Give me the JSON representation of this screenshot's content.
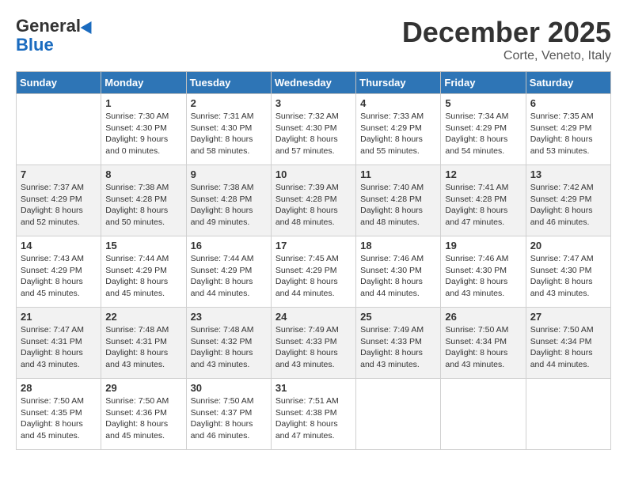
{
  "header": {
    "logo_general": "General",
    "logo_blue": "Blue",
    "month_title": "December 2025",
    "location": "Corte, Veneto, Italy"
  },
  "days_of_week": [
    "Sunday",
    "Monday",
    "Tuesday",
    "Wednesday",
    "Thursday",
    "Friday",
    "Saturday"
  ],
  "weeks": [
    [
      {
        "day": "",
        "sunrise": "",
        "sunset": "",
        "daylight": ""
      },
      {
        "day": "1",
        "sunrise": "Sunrise: 7:30 AM",
        "sunset": "Sunset: 4:30 PM",
        "daylight": "Daylight: 9 hours and 0 minutes."
      },
      {
        "day": "2",
        "sunrise": "Sunrise: 7:31 AM",
        "sunset": "Sunset: 4:30 PM",
        "daylight": "Daylight: 8 hours and 58 minutes."
      },
      {
        "day": "3",
        "sunrise": "Sunrise: 7:32 AM",
        "sunset": "Sunset: 4:30 PM",
        "daylight": "Daylight: 8 hours and 57 minutes."
      },
      {
        "day": "4",
        "sunrise": "Sunrise: 7:33 AM",
        "sunset": "Sunset: 4:29 PM",
        "daylight": "Daylight: 8 hours and 55 minutes."
      },
      {
        "day": "5",
        "sunrise": "Sunrise: 7:34 AM",
        "sunset": "Sunset: 4:29 PM",
        "daylight": "Daylight: 8 hours and 54 minutes."
      },
      {
        "day": "6",
        "sunrise": "Sunrise: 7:35 AM",
        "sunset": "Sunset: 4:29 PM",
        "daylight": "Daylight: 8 hours and 53 minutes."
      }
    ],
    [
      {
        "day": "7",
        "sunrise": "Sunrise: 7:37 AM",
        "sunset": "Sunset: 4:29 PM",
        "daylight": "Daylight: 8 hours and 52 minutes."
      },
      {
        "day": "8",
        "sunrise": "Sunrise: 7:38 AM",
        "sunset": "Sunset: 4:28 PM",
        "daylight": "Daylight: 8 hours and 50 minutes."
      },
      {
        "day": "9",
        "sunrise": "Sunrise: 7:38 AM",
        "sunset": "Sunset: 4:28 PM",
        "daylight": "Daylight: 8 hours and 49 minutes."
      },
      {
        "day": "10",
        "sunrise": "Sunrise: 7:39 AM",
        "sunset": "Sunset: 4:28 PM",
        "daylight": "Daylight: 8 hours and 48 minutes."
      },
      {
        "day": "11",
        "sunrise": "Sunrise: 7:40 AM",
        "sunset": "Sunset: 4:28 PM",
        "daylight": "Daylight: 8 hours and 48 minutes."
      },
      {
        "day": "12",
        "sunrise": "Sunrise: 7:41 AM",
        "sunset": "Sunset: 4:28 PM",
        "daylight": "Daylight: 8 hours and 47 minutes."
      },
      {
        "day": "13",
        "sunrise": "Sunrise: 7:42 AM",
        "sunset": "Sunset: 4:29 PM",
        "daylight": "Daylight: 8 hours and 46 minutes."
      }
    ],
    [
      {
        "day": "14",
        "sunrise": "Sunrise: 7:43 AM",
        "sunset": "Sunset: 4:29 PM",
        "daylight": "Daylight: 8 hours and 45 minutes."
      },
      {
        "day": "15",
        "sunrise": "Sunrise: 7:44 AM",
        "sunset": "Sunset: 4:29 PM",
        "daylight": "Daylight: 8 hours and 45 minutes."
      },
      {
        "day": "16",
        "sunrise": "Sunrise: 7:44 AM",
        "sunset": "Sunset: 4:29 PM",
        "daylight": "Daylight: 8 hours and 44 minutes."
      },
      {
        "day": "17",
        "sunrise": "Sunrise: 7:45 AM",
        "sunset": "Sunset: 4:29 PM",
        "daylight": "Daylight: 8 hours and 44 minutes."
      },
      {
        "day": "18",
        "sunrise": "Sunrise: 7:46 AM",
        "sunset": "Sunset: 4:30 PM",
        "daylight": "Daylight: 8 hours and 44 minutes."
      },
      {
        "day": "19",
        "sunrise": "Sunrise: 7:46 AM",
        "sunset": "Sunset: 4:30 PM",
        "daylight": "Daylight: 8 hours and 43 minutes."
      },
      {
        "day": "20",
        "sunrise": "Sunrise: 7:47 AM",
        "sunset": "Sunset: 4:30 PM",
        "daylight": "Daylight: 8 hours and 43 minutes."
      }
    ],
    [
      {
        "day": "21",
        "sunrise": "Sunrise: 7:47 AM",
        "sunset": "Sunset: 4:31 PM",
        "daylight": "Daylight: 8 hours and 43 minutes."
      },
      {
        "day": "22",
        "sunrise": "Sunrise: 7:48 AM",
        "sunset": "Sunset: 4:31 PM",
        "daylight": "Daylight: 8 hours and 43 minutes."
      },
      {
        "day": "23",
        "sunrise": "Sunrise: 7:48 AM",
        "sunset": "Sunset: 4:32 PM",
        "daylight": "Daylight: 8 hours and 43 minutes."
      },
      {
        "day": "24",
        "sunrise": "Sunrise: 7:49 AM",
        "sunset": "Sunset: 4:33 PM",
        "daylight": "Daylight: 8 hours and 43 minutes."
      },
      {
        "day": "25",
        "sunrise": "Sunrise: 7:49 AM",
        "sunset": "Sunset: 4:33 PM",
        "daylight": "Daylight: 8 hours and 43 minutes."
      },
      {
        "day": "26",
        "sunrise": "Sunrise: 7:50 AM",
        "sunset": "Sunset: 4:34 PM",
        "daylight": "Daylight: 8 hours and 43 minutes."
      },
      {
        "day": "27",
        "sunrise": "Sunrise: 7:50 AM",
        "sunset": "Sunset: 4:34 PM",
        "daylight": "Daylight: 8 hours and 44 minutes."
      }
    ],
    [
      {
        "day": "28",
        "sunrise": "Sunrise: 7:50 AM",
        "sunset": "Sunset: 4:35 PM",
        "daylight": "Daylight: 8 hours and 45 minutes."
      },
      {
        "day": "29",
        "sunrise": "Sunrise: 7:50 AM",
        "sunset": "Sunset: 4:36 PM",
        "daylight": "Daylight: 8 hours and 45 minutes."
      },
      {
        "day": "30",
        "sunrise": "Sunrise: 7:50 AM",
        "sunset": "Sunset: 4:37 PM",
        "daylight": "Daylight: 8 hours and 46 minutes."
      },
      {
        "day": "31",
        "sunrise": "Sunrise: 7:51 AM",
        "sunset": "Sunset: 4:38 PM",
        "daylight": "Daylight: 8 hours and 47 minutes."
      },
      {
        "day": "",
        "sunrise": "",
        "sunset": "",
        "daylight": ""
      },
      {
        "day": "",
        "sunrise": "",
        "sunset": "",
        "daylight": ""
      },
      {
        "day": "",
        "sunrise": "",
        "sunset": "",
        "daylight": ""
      }
    ]
  ]
}
